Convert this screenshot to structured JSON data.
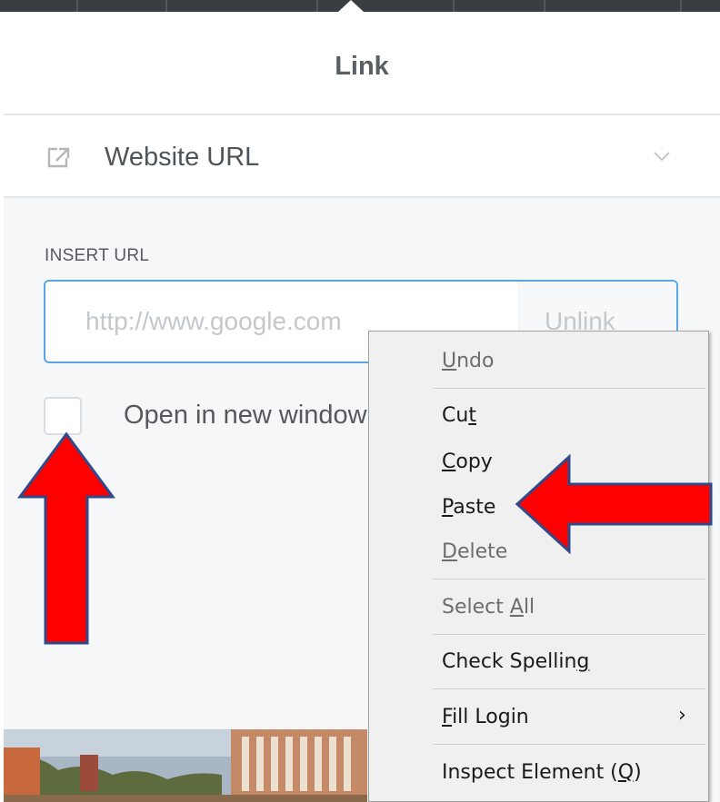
{
  "dialog": {
    "title": "Link",
    "link_type": "Website URL",
    "section_label": "INSERT URL",
    "url_placeholder": "http://www.google.com",
    "url_value": "",
    "unlink_label": "Unlink",
    "open_new_window_label": "Open in new window",
    "open_new_window_checked": false
  },
  "context_menu": {
    "items": [
      {
        "pre": "",
        "key": "U",
        "post": "ndo",
        "enabled": false
      },
      {
        "pre": "Cu",
        "key": "t",
        "post": "",
        "enabled": true
      },
      {
        "pre": "",
        "key": "C",
        "post": "opy",
        "enabled": true
      },
      {
        "pre": "",
        "key": "P",
        "post": "aste",
        "enabled": true
      },
      {
        "pre": "",
        "key": "D",
        "post": "elete",
        "enabled": false
      },
      {
        "pre": "Select ",
        "key": "A",
        "post": "ll",
        "enabled": false
      },
      {
        "pre": "Check Spellin",
        "key": "g",
        "post": "",
        "enabled": true
      },
      {
        "pre": "",
        "key": "F",
        "post": "ill Login",
        "enabled": true,
        "submenu": true,
        "submenu_glyph": "›"
      },
      {
        "pre": "Inspect Element (",
        "key": "Q",
        "post": ")",
        "enabled": true
      }
    ]
  },
  "annotations": {
    "arrow_color": "#ff0000",
    "arrow_outline": "#2f4a8a"
  },
  "colors": {
    "focus_border": "#5ba4e6",
    "toolbar": "#3a3d41"
  }
}
